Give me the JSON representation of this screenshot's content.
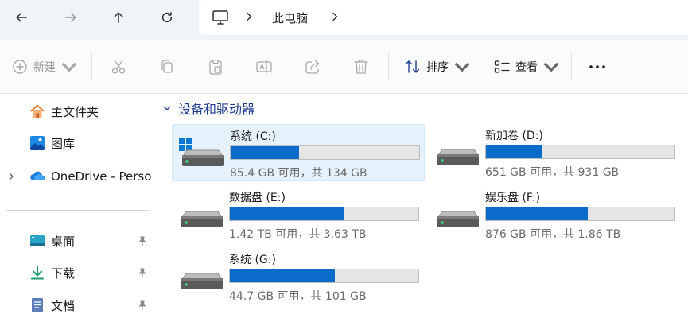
{
  "colors": {
    "accent": "#0b6bcb",
    "group_title": "#1f3c8f",
    "selection": "#e5f1fb",
    "chrome": "#eff4f9"
  },
  "nav": {
    "back_icon": "arrow-left-icon",
    "forward_icon": "arrow-right-icon",
    "up_icon": "arrow-up-icon",
    "refresh_icon": "refresh-icon"
  },
  "address": {
    "root_icon": "computer-icon",
    "crumb": "此电脑"
  },
  "toolbar": {
    "new_label": "新建",
    "sort_label": "排序",
    "view_label": "查看",
    "more_label": "···",
    "icons": [
      "cut-icon",
      "copy-icon",
      "paste-icon",
      "rename-icon",
      "share-icon",
      "delete-icon"
    ]
  },
  "sidebar": {
    "items": [
      {
        "label": "主文件夹",
        "icon": "home-icon"
      },
      {
        "label": "图库",
        "icon": "gallery-icon"
      },
      {
        "label": "OneDrive - Perso",
        "icon": "onedrive-icon"
      },
      {
        "label": "桌面",
        "icon": "desktop-icon"
      },
      {
        "label": "下载",
        "icon": "download-icon"
      },
      {
        "label": "文档",
        "icon": "documents-icon"
      }
    ]
  },
  "group": {
    "title": "设备和驱动器"
  },
  "drives": [
    {
      "name": "系统 (C:)",
      "info": "85.4 GB 可用，共 134 GB",
      "used_fraction": 0.363,
      "selected": true,
      "windows": true
    },
    {
      "name": "新加卷 (D:)",
      "info": "651 GB 可用，共 931 GB",
      "used_fraction": 0.3,
      "selected": false,
      "windows": false
    },
    {
      "name": "数据盘 (E:)",
      "info": "1.42 TB 可用，共 3.63 TB",
      "used_fraction": 0.609,
      "selected": false,
      "windows": false
    },
    {
      "name": "娱乐盘 (F:)",
      "info": "876 GB 可用，共 1.86 TB",
      "used_fraction": 0.54,
      "selected": false,
      "windows": false
    },
    {
      "name": "系统 (G:)",
      "info": "44.7 GB 可用，共 101 GB",
      "used_fraction": 0.557,
      "selected": false,
      "windows": false
    }
  ]
}
